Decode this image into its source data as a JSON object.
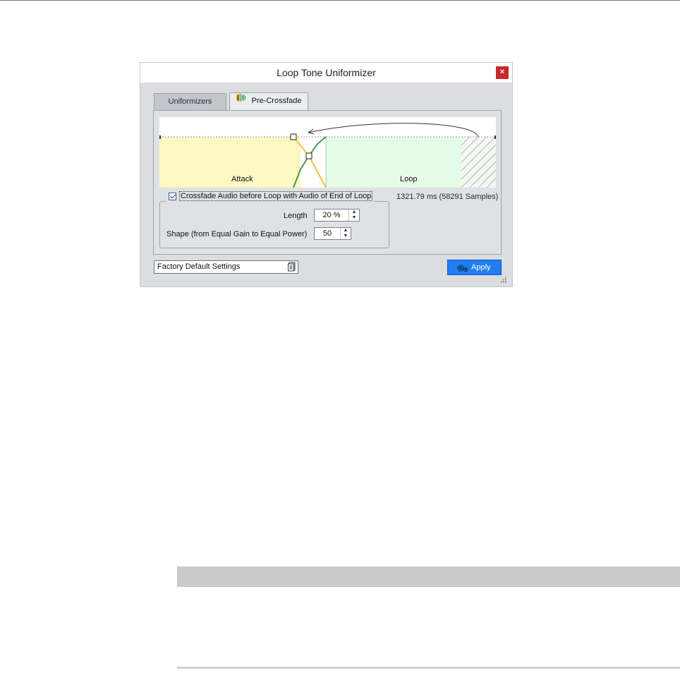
{
  "window": {
    "title": "Loop Tone Uniformizer",
    "close_label": "×"
  },
  "tabs": [
    {
      "label": "Uniformizers",
      "active": false
    },
    {
      "label": "Pre-Crossfade",
      "active": true
    }
  ],
  "graph": {
    "attack_label": "Attack",
    "loop_label": "Loop",
    "colors": {
      "attack_region": "#fbf8c3",
      "loop_region": "#e5fbe5",
      "fade_out": "#f0c23a",
      "fade_in": "#4a9a45"
    }
  },
  "crossfade": {
    "checkbox_label": "Crossfade Audio before Loop with Audio of End of Loop",
    "checked": true,
    "duration_text": "1321.79 ms (58291 Samples)",
    "length_label": "Length",
    "length_value": "20 %",
    "shape_label": "Shape (from Equal Gain to Equal Power)",
    "shape_value": "50"
  },
  "footer": {
    "preset_label": "Factory Default Settings",
    "apply_label": "Apply"
  },
  "colors": {
    "accent": "#1f7ef0",
    "close": "#c8282b"
  }
}
